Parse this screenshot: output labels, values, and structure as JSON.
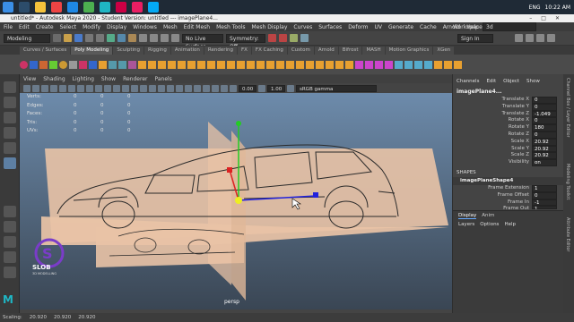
{
  "window": {
    "title": "untitled* - Autodesk Maya 2020 - Student Version: untitled   ---   imagePlane4..."
  },
  "taskbar": {
    "lang": "ENG",
    "time": "10:22 AM"
  },
  "menubar": {
    "items": [
      "File",
      "Edit",
      "Create",
      "Select",
      "Modify",
      "Display",
      "Windows",
      "Mesh",
      "Edit Mesh",
      "Mesh Tools",
      "Mesh Display",
      "Curves",
      "Surfaces",
      "Deform",
      "UV",
      "Generate",
      "Cache",
      "Arnold",
      "Help"
    ],
    "workspace_label": "Workspace :",
    "workspace_value": "3d"
  },
  "statusline": {
    "mode": "Modeling",
    "live": "No Live Surface",
    "symmetry": "Symmetry: Off",
    "signin": "Sign In"
  },
  "shelf": {
    "tabs": [
      "Curves / Surfaces",
      "Poly Modeling",
      "Sculpting",
      "Rigging",
      "Animation",
      "Rendering",
      "FX",
      "FX Caching",
      "Custom",
      "Arnold",
      "Bifrost",
      "MASH",
      "Motion Graphics",
      "XGen"
    ],
    "active_tab": "Poly Modeling"
  },
  "viewport": {
    "menu": [
      "View",
      "Shading",
      "Lighting",
      "Show",
      "Renderer",
      "Panels"
    ],
    "exposure": "0.00",
    "gamma": "1.00",
    "colorspace": "sRGB gamma",
    "hud": [
      {
        "label": "Verts:",
        "a": "0",
        "b": "0",
        "c": "0"
      },
      {
        "label": "Edges:",
        "a": "0",
        "b": "0",
        "c": "0"
      },
      {
        "label": "Faces:",
        "a": "0",
        "b": "0",
        "c": "0"
      },
      {
        "label": "Tris:",
        "a": "0",
        "b": "0",
        "c": "0"
      },
      {
        "label": "UVs:",
        "a": "0",
        "b": "0",
        "c": "0"
      }
    ],
    "camera": "persp"
  },
  "channelbox": {
    "menu": [
      "Channels",
      "Edit",
      "Object",
      "Show"
    ],
    "object": "imagePlane4...",
    "attrs": [
      {
        "name": "Translate X",
        "value": "0"
      },
      {
        "name": "Translate Y",
        "value": "0"
      },
      {
        "name": "Translate Z",
        "value": "-1.049"
      },
      {
        "name": "Rotate X",
        "value": "0"
      },
      {
        "name": "Rotate Y",
        "value": "180"
      },
      {
        "name": "Rotate Z",
        "value": "0"
      },
      {
        "name": "Scale X",
        "value": "20.92"
      },
      {
        "name": "Scale Y",
        "value": "20.92"
      },
      {
        "name": "Scale Z",
        "value": "20.92"
      },
      {
        "name": "Visibility",
        "value": "on"
      }
    ],
    "shapes_header": "SHAPES",
    "shape_name": "imagePlaneShape4",
    "shape_attrs": [
      {
        "name": "Frame Extension",
        "value": "1"
      },
      {
        "name": "Frame Offset",
        "value": "0"
      },
      {
        "name": "Frame In",
        "value": "-1"
      },
      {
        "name": "Frame Out",
        "value": "1"
      }
    ]
  },
  "layers": {
    "tabs": [
      "Display",
      "Anim"
    ],
    "menu": [
      "Layers",
      "Options",
      "Help"
    ]
  },
  "sidetabs": [
    "Channel Box / Layer Editor",
    "Modeling Toolkit",
    "Attribute Editor"
  ],
  "helpline": {
    "label": "Scaling:",
    "x": "20.920",
    "y": "20.920",
    "z": "20.920"
  },
  "watermark": {
    "text": "SLOB",
    "subtext": "3D MODELLING"
  },
  "colors": {
    "plane": "#e9c3a6",
    "viewport_top": "#6d8bab",
    "viewport_bottom": "#3a4654",
    "manip_x": "#d22",
    "manip_y": "#2c2",
    "manip_z": "#22d",
    "manip_center": "#ee2"
  }
}
